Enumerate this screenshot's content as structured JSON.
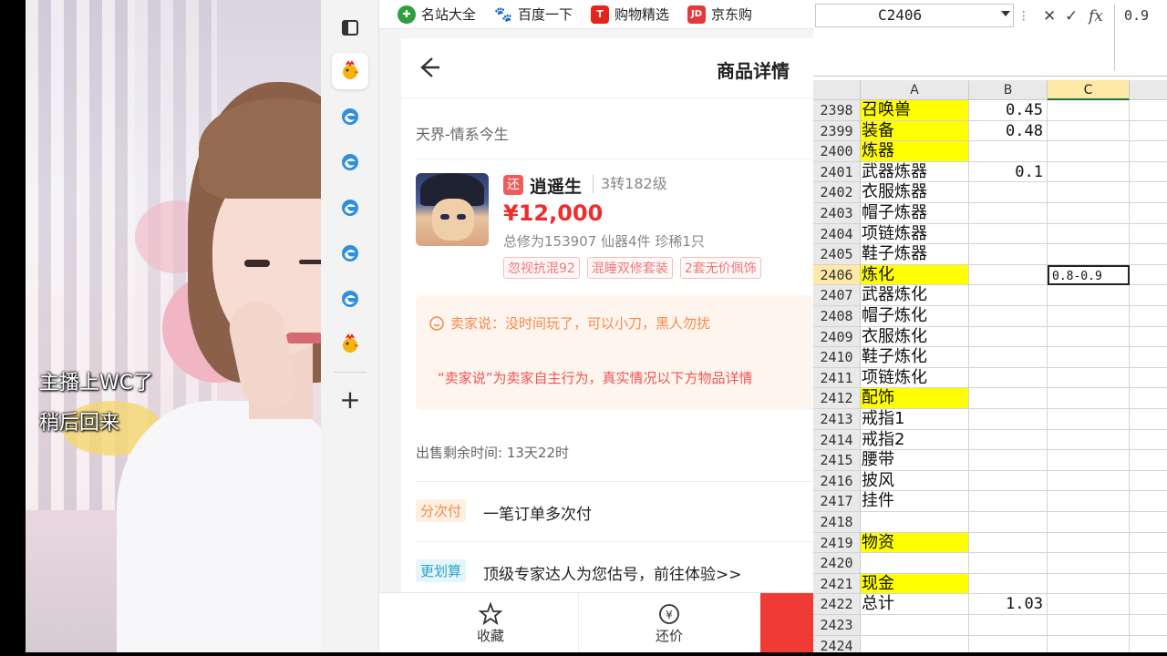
{
  "stream": {
    "overlay_line1": "主播上WC了",
    "overlay_line2": "稍后回来"
  },
  "bookmarks": [
    {
      "label": "名站大全",
      "icon": "site-nav-icon",
      "color": "#2e9e3f"
    },
    {
      "label": "百度一下",
      "icon": "baidu-paw-icon",
      "color": "#2f6bd8"
    },
    {
      "label": "购物精选",
      "icon": "shopping-t-icon",
      "color": "#e8231d"
    },
    {
      "label": "京东购",
      "icon": "jd-icon",
      "color": "#e4393c"
    }
  ],
  "sidebar": {
    "icons": [
      "tabs-icon",
      "game-chicken-icon",
      "edge-browser-icon",
      "edge-browser-icon",
      "edge-browser-icon",
      "edge-browser-icon",
      "edge-browser-icon",
      "game-chicken-icon",
      "add-icon"
    ],
    "add_label": "+"
  },
  "product": {
    "page_title": "商品详情",
    "server": "天界-情系今生",
    "tag": "还",
    "character_name": "逍遥生",
    "level": "3转182级",
    "price": "¥12,000",
    "stats": "总修为153907  仙器4件  珍稀1只",
    "chips": [
      "忽视抗混92",
      "混睡双修套装",
      "2套无价佩饰"
    ],
    "seller_say": "卖家说：没时间玩了，可以小刀，黑人勿扰",
    "seller_note": "“卖家说”为卖家自主行为，真实情况以下方物品详情",
    "remaining": "出售剩余时间: 13天22时",
    "installment_badge": "分次付",
    "installment_text": "一笔订单多次付",
    "appraise_badge": "更划算",
    "appraise_text": "顶级专家达人为您估号，前往体验>>",
    "bottom": {
      "favorite": "收藏",
      "bargain": "还价"
    },
    "accent": "#f02c2c"
  },
  "excel": {
    "name_box": "C2406",
    "formula_value": "0.9",
    "columns": [
      "A",
      "B",
      "C"
    ],
    "rows": [
      {
        "n": "2398",
        "a": "召唤兽",
        "y": true,
        "b": "0.45",
        "c": ""
      },
      {
        "n": "2399",
        "a": "装备",
        "y": true,
        "b": "0.48",
        "c": ""
      },
      {
        "n": "2400",
        "a": "炼器",
        "y": true,
        "b": "",
        "c": ""
      },
      {
        "n": "2401",
        "a": "武器炼器",
        "y": false,
        "b": "0.1",
        "c": ""
      },
      {
        "n": "2402",
        "a": "衣服炼器",
        "y": false,
        "b": "",
        "c": ""
      },
      {
        "n": "2403",
        "a": "帽子炼器",
        "y": false,
        "b": "",
        "c": ""
      },
      {
        "n": "2404",
        "a": "项链炼器",
        "y": false,
        "b": "",
        "c": ""
      },
      {
        "n": "2405",
        "a": "鞋子炼器",
        "y": false,
        "b": "",
        "c": ""
      },
      {
        "n": "2406",
        "a": "炼化",
        "y": true,
        "b": "",
        "c": "0.8-0.9",
        "active": true
      },
      {
        "n": "2407",
        "a": "武器炼化",
        "y": false,
        "b": "",
        "c": ""
      },
      {
        "n": "2408",
        "a": "帽子炼化",
        "y": false,
        "b": "",
        "c": ""
      },
      {
        "n": "2409",
        "a": "衣服炼化",
        "y": false,
        "b": "",
        "c": ""
      },
      {
        "n": "2410",
        "a": "鞋子炼化",
        "y": false,
        "b": "",
        "c": ""
      },
      {
        "n": "2411",
        "a": "项链炼化",
        "y": false,
        "b": "",
        "c": ""
      },
      {
        "n": "2412",
        "a": "配饰",
        "y": true,
        "b": "",
        "c": ""
      },
      {
        "n": "2413",
        "a": "戒指1",
        "y": false,
        "b": "",
        "c": ""
      },
      {
        "n": "2414",
        "a": "戒指2",
        "y": false,
        "b": "",
        "c": ""
      },
      {
        "n": "2415",
        "a": "腰带",
        "y": false,
        "b": "",
        "c": ""
      },
      {
        "n": "2416",
        "a": "披风",
        "y": false,
        "b": "",
        "c": ""
      },
      {
        "n": "2417",
        "a": "挂件",
        "y": false,
        "b": "",
        "c": ""
      },
      {
        "n": "2418",
        "a": "",
        "y": false,
        "b": "",
        "c": ""
      },
      {
        "n": "2419",
        "a": "物资",
        "y": true,
        "b": "",
        "c": ""
      },
      {
        "n": "2420",
        "a": "",
        "y": false,
        "b": "",
        "c": ""
      },
      {
        "n": "2421",
        "a": "现金",
        "y": true,
        "b": "",
        "c": ""
      },
      {
        "n": "2422",
        "a": "总计",
        "y": false,
        "b": "1.03",
        "c": ""
      },
      {
        "n": "2423",
        "a": "",
        "y": false,
        "b": "",
        "c": ""
      },
      {
        "n": "2424",
        "a": "",
        "y": false,
        "b": "",
        "c": ""
      }
    ]
  }
}
